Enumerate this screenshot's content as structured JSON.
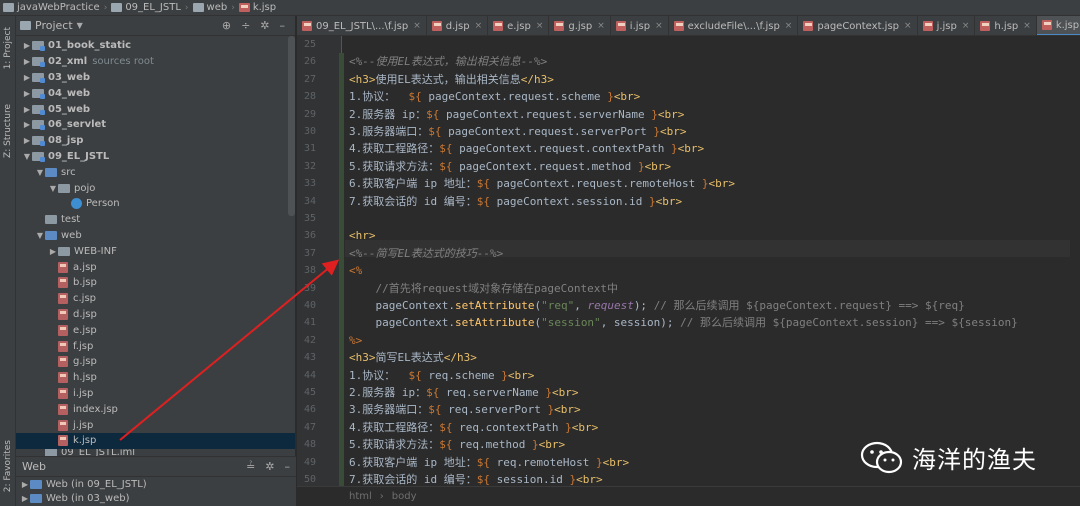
{
  "breadcrumb": [
    {
      "label": "javaWebPractice",
      "icon": "folder-icon"
    },
    {
      "label": "09_EL_JSTL",
      "icon": "folder-icon"
    },
    {
      "label": "web",
      "icon": "folder-icon"
    },
    {
      "label": "k.jsp",
      "icon": "jsp-file-icon"
    }
  ],
  "left_strip": {
    "project_tab": "1: Project",
    "structure_tab": "Z: Structure",
    "favorites_tab": "2: Favorites"
  },
  "project_panel": {
    "title": "Project",
    "tree": [
      {
        "label": "01_book_static",
        "depth": 0,
        "expanded": false,
        "bold": true,
        "icon": "module-folder-icon"
      },
      {
        "label": "02_xml",
        "extra": "sources root",
        "depth": 0,
        "expanded": false,
        "bold": true,
        "icon": "module-folder-icon"
      },
      {
        "label": "03_web",
        "depth": 0,
        "expanded": false,
        "bold": true,
        "icon": "module-folder-icon"
      },
      {
        "label": "04_web",
        "depth": 0,
        "expanded": false,
        "bold": true,
        "icon": "module-folder-icon"
      },
      {
        "label": "05_web",
        "depth": 0,
        "expanded": false,
        "bold": true,
        "icon": "module-folder-icon"
      },
      {
        "label": "06_servlet",
        "depth": 0,
        "expanded": false,
        "bold": true,
        "icon": "module-folder-icon"
      },
      {
        "label": "08_jsp",
        "depth": 0,
        "expanded": false,
        "bold": true,
        "icon": "module-folder-icon"
      },
      {
        "label": "09_EL_JSTL",
        "depth": 0,
        "expanded": true,
        "bold": true,
        "icon": "module-folder-icon"
      },
      {
        "label": "src",
        "depth": 1,
        "expanded": true,
        "icon": "source-folder-icon"
      },
      {
        "label": "pojo",
        "depth": 2,
        "expanded": true,
        "icon": "package-icon"
      },
      {
        "label": "Person",
        "depth": 3,
        "icon": "class-icon"
      },
      {
        "label": "test",
        "depth": 1,
        "icon": "folder-icon"
      },
      {
        "label": "web",
        "depth": 1,
        "expanded": true,
        "icon": "web-folder-icon"
      },
      {
        "label": "WEB-INF",
        "depth": 2,
        "expanded": false,
        "icon": "folder-icon"
      },
      {
        "label": "a.jsp",
        "depth": 2,
        "icon": "jsp-file-icon"
      },
      {
        "label": "b.jsp",
        "depth": 2,
        "icon": "jsp-file-icon"
      },
      {
        "label": "c.jsp",
        "depth": 2,
        "icon": "jsp-file-icon"
      },
      {
        "label": "d.jsp",
        "depth": 2,
        "icon": "jsp-file-icon"
      },
      {
        "label": "e.jsp",
        "depth": 2,
        "icon": "jsp-file-icon"
      },
      {
        "label": "f.jsp",
        "depth": 2,
        "icon": "jsp-file-icon"
      },
      {
        "label": "g.jsp",
        "depth": 2,
        "icon": "jsp-file-icon"
      },
      {
        "label": "h.jsp",
        "depth": 2,
        "icon": "jsp-file-icon"
      },
      {
        "label": "i.jsp",
        "depth": 2,
        "icon": "jsp-file-icon"
      },
      {
        "label": "index.jsp",
        "depth": 2,
        "icon": "jsp-file-icon"
      },
      {
        "label": "j.jsp",
        "depth": 2,
        "icon": "jsp-file-icon"
      },
      {
        "label": "k.jsp",
        "depth": 2,
        "icon": "jsp-file-icon",
        "selected": true
      },
      {
        "label": "09_EL_JSTL.iml",
        "depth": 1,
        "icon": "iml-file-icon"
      }
    ]
  },
  "web_panel": {
    "title": "Web",
    "items": [
      "Web (in 09_EL_JSTL)",
      "Web (in 03_web)"
    ]
  },
  "editor": {
    "tabs": [
      {
        "label": "09_EL_JSTL\\...\\f.jsp"
      },
      {
        "label": "d.jsp"
      },
      {
        "label": "e.jsp"
      },
      {
        "label": "g.jsp"
      },
      {
        "label": "i.jsp"
      },
      {
        "label": "excludeFile\\...\\f.jsp"
      },
      {
        "label": "pageContext.jsp"
      },
      {
        "label": "j.jsp"
      },
      {
        "label": "h.jsp"
      },
      {
        "label": "k.jsp",
        "active": true
      }
    ],
    "line_numbers": [
      "25",
      "26",
      "27",
      "28",
      "29",
      "30",
      "31",
      "32",
      "33",
      "34",
      "35",
      "36",
      "37",
      "38",
      "39",
      "40",
      "41",
      "42",
      "43",
      "44",
      "45",
      "46",
      "47",
      "48",
      "49",
      "50"
    ],
    "status_path": [
      "html",
      "body"
    ]
  },
  "watermark": {
    "text": "海洋的渔夫"
  }
}
